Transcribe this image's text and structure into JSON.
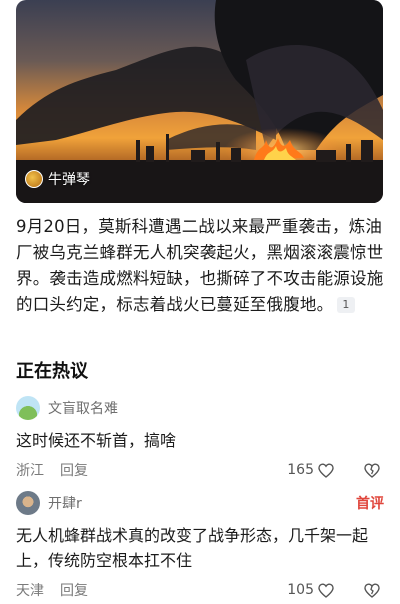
{
  "hero": {
    "source_name": "牛弹琴"
  },
  "article": {
    "text": "9月20日，莫斯科遭遇二战以来最严重袭击，炼油厂被乌克兰蜂群无人机突袭起火，黑烟滚滚震惊世界。袭击造成燃料短缺，也撕碎了不攻击能源设施的口头约定，标志着战火已蔓延至俄腹地。",
    "citation": "1"
  },
  "section": {
    "title": "正在热议"
  },
  "comments": [
    {
      "user": "文盲取名难",
      "text": "这时候还不斩首，搞啥",
      "location": "浙江",
      "reply_label": "回复",
      "likes": "165",
      "badge": ""
    },
    {
      "user": "开肆r",
      "text": "无人机蜂群战术真的改变了战争形态，几千架一起上，传统防空根本扛不住",
      "location": "天津",
      "reply_label": "回复",
      "likes": "105",
      "badge": "首评"
    }
  ]
}
